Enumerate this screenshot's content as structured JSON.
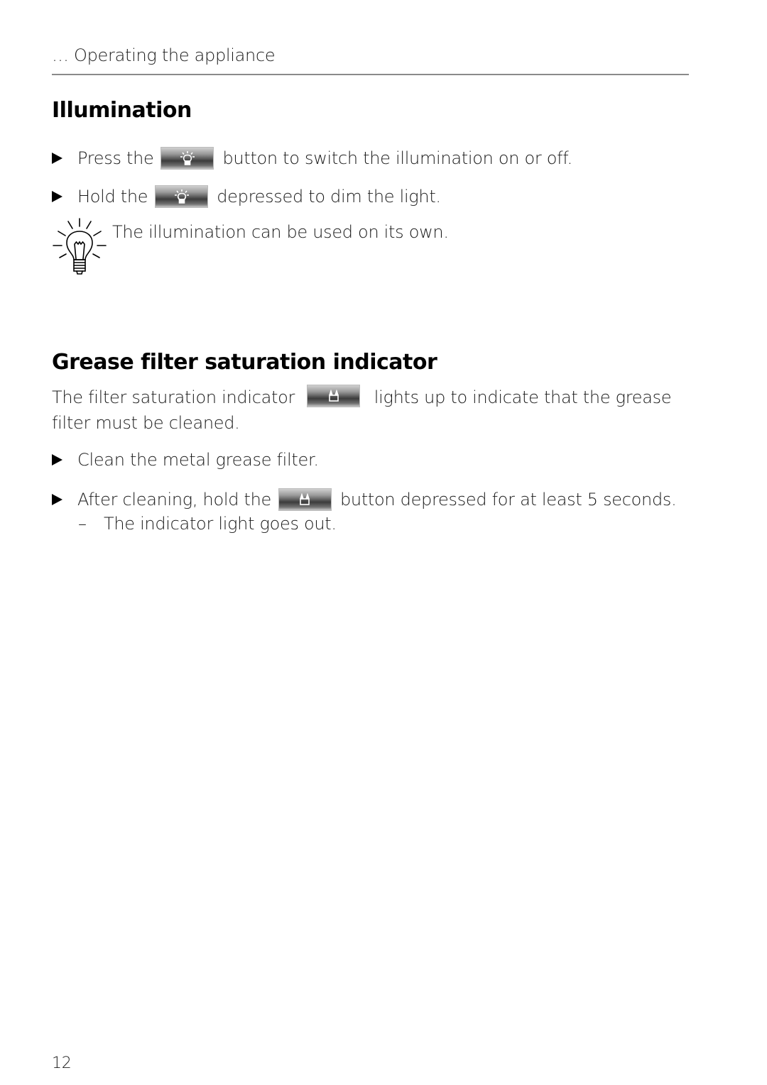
{
  "header": {
    "running_title": "… Operating the appliance"
  },
  "illumination": {
    "heading": "Illumination",
    "steps": [
      {
        "before": "Press the",
        "button_icon": "light-bulb-icon",
        "after": "button to switch the illumination on or off."
      },
      {
        "before": "Hold the",
        "button_icon": "light-bulb-icon",
        "after": "depressed to dim the light."
      }
    ],
    "note": {
      "icon": "tip-light-bulb-icon",
      "text": "The illumination can be used on its own."
    }
  },
  "grease_filter": {
    "heading": "Grease filter saturation indicator",
    "intro_before": "The filter saturation indicator",
    "intro_icon": "grease-filter-icon",
    "intro_after": "lights up to indicate that the grease filter must be cleaned.",
    "steps": [
      {
        "text": "Clean the metal grease filter."
      },
      {
        "before": "After cleaning, hold the",
        "button_icon": "grease-filter-icon",
        "after": "button depressed for at least 5 seconds."
      }
    ],
    "result": {
      "dash": "–",
      "text": "The indicator light goes out."
    }
  },
  "footer": {
    "page_number": "12"
  }
}
